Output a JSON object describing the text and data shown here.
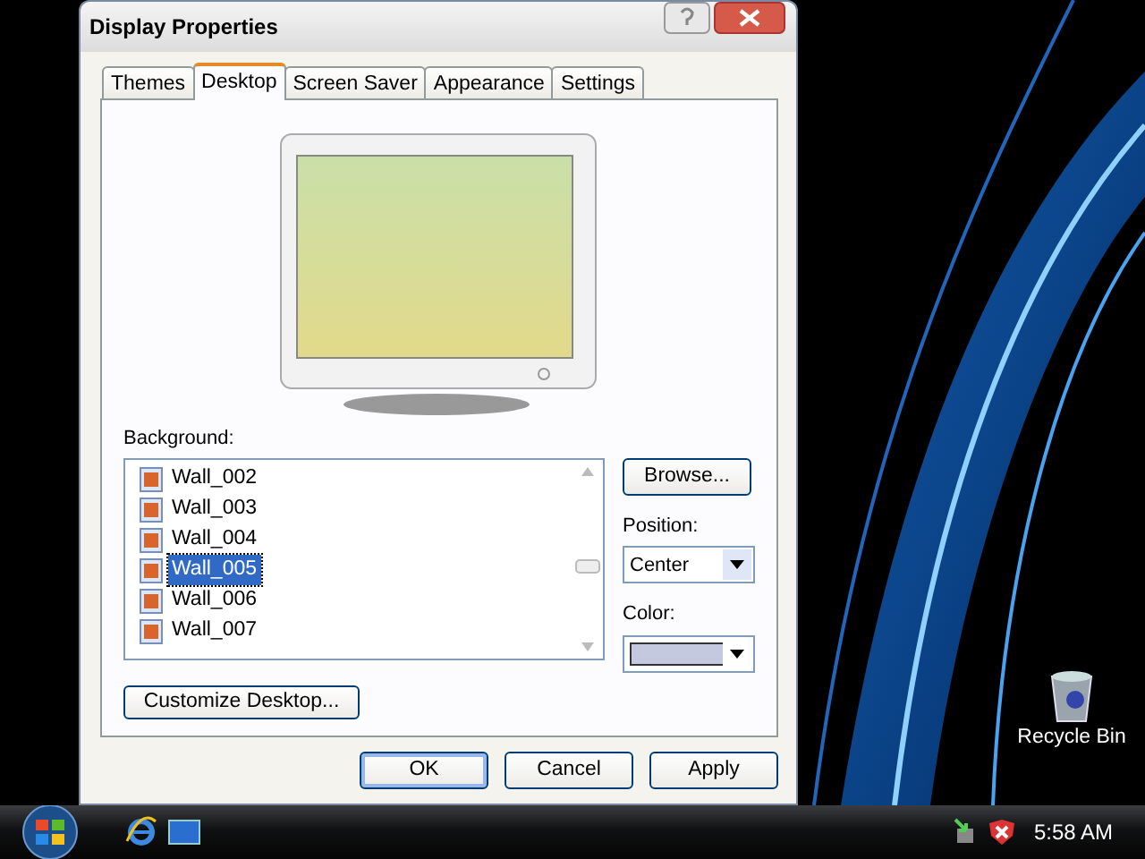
{
  "window": {
    "title": "Display Properties"
  },
  "tabs": [
    {
      "label": "Themes",
      "selected": false
    },
    {
      "label": "Desktop",
      "selected": true
    },
    {
      "label": "Screen Saver",
      "selected": false
    },
    {
      "label": "Appearance",
      "selected": false
    },
    {
      "label": "Settings",
      "selected": false
    }
  ],
  "background": {
    "label": "Background:",
    "items": [
      {
        "name": "Wall_002",
        "selected": false
      },
      {
        "name": "Wall_003",
        "selected": false
      },
      {
        "name": "Wall_004",
        "selected": false
      },
      {
        "name": "Wall_005",
        "selected": true
      },
      {
        "name": "Wall_006",
        "selected": false
      },
      {
        "name": "Wall_007",
        "selected": false
      }
    ]
  },
  "browse_button": "Browse...",
  "position": {
    "label": "Position:",
    "value": "Center"
  },
  "color": {
    "label": "Color:"
  },
  "customize_button": "Customize Desktop...",
  "buttons": [
    {
      "label": "OK",
      "default": true
    },
    {
      "label": "Cancel",
      "default": false
    },
    {
      "label": "Apply",
      "default": false
    }
  ],
  "desktop_icons": [
    {
      "label": "Recycle Bin"
    }
  ],
  "taskbar": {
    "clock": "5:58 AM"
  }
}
